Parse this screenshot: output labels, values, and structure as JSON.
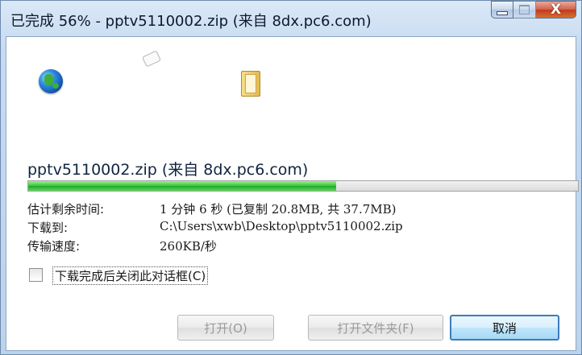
{
  "window": {
    "title": "已完成 56% - pptv5110002.zip (来自 8dx.pc6.com)",
    "controls": {
      "minimize": "minimize",
      "maximize": "maximize",
      "close": "X"
    }
  },
  "download": {
    "file_label": "pptv5110002.zip (来自 8dx.pc6.com)",
    "progress_percent": 56,
    "rows": [
      {
        "label": "估计剩余时间:",
        "value": "1 分钟 6 秒 (已复制 20.8MB, 共 37.7MB)"
      },
      {
        "label": "下载到:",
        "value": "C:\\Users\\xwb\\Desktop\\pptv5110002.zip"
      },
      {
        "label": "传输速度:",
        "value": "260KB/秒"
      }
    ],
    "close_on_complete": {
      "label": "下载完成后关闭此对话框(C)",
      "checked": false
    }
  },
  "buttons": {
    "open": "打开(O)",
    "open_folder": "打开文件夹(F)",
    "cancel": "取消"
  },
  "colors": {
    "progress_fill": "#37c23a",
    "titlebar_bg": "#dbe8f6",
    "close_button": "#c0391f",
    "primary_border": "#3d7bbd"
  },
  "icons": [
    "globe-icon",
    "flying-paper-icon",
    "folder-icon"
  ]
}
